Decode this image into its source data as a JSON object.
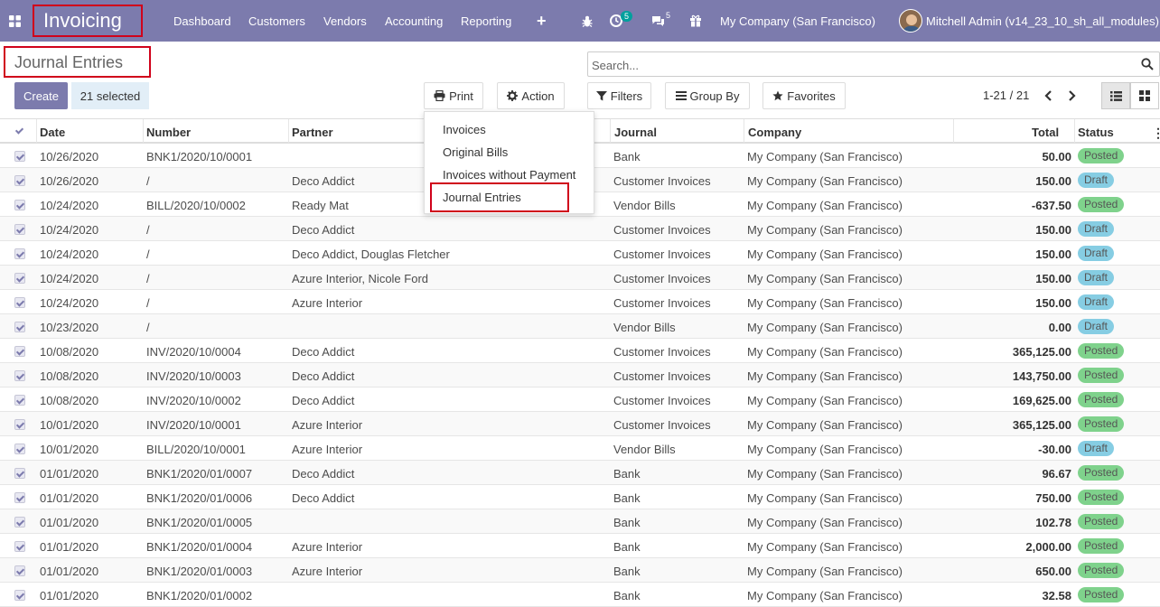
{
  "navbar": {
    "app_title": "Invoicing",
    "menus": [
      "Dashboard",
      "Customers",
      "Vendors",
      "Accounting",
      "Reporting"
    ],
    "activity_count": "5",
    "messages_count": "5",
    "company": "My Company (San Francisco)",
    "user": "Mitchell Admin (v14_23_10_sh_all_modules)"
  },
  "control_panel": {
    "title": "Journal Entries",
    "search_placeholder": "Search...",
    "create_label": "Create",
    "selected_label": "21 selected",
    "print_label": "Print",
    "action_label": "Action",
    "filters_label": "Filters",
    "groupby_label": "Group By",
    "favorites_label": "Favorites",
    "pager": "1-21 / 21"
  },
  "print_menu": {
    "items": [
      "Invoices",
      "Original Bills",
      "Invoices without Payment",
      "Journal Entries"
    ]
  },
  "table": {
    "headers": {
      "date": "Date",
      "number": "Number",
      "partner": "Partner",
      "journal": "Journal",
      "company": "Company",
      "total": "Total",
      "status": "Status"
    },
    "rows": [
      {
        "date": "10/26/2020",
        "number": "BNK1/2020/10/0001",
        "partner": "",
        "journal": "Bank",
        "company": "My Company (San Francisco)",
        "total": "50.00",
        "status": "Posted"
      },
      {
        "date": "10/26/2020",
        "number": "/",
        "partner": "Deco Addict",
        "journal": "Customer Invoices",
        "company": "My Company (San Francisco)",
        "total": "150.00",
        "status": "Draft"
      },
      {
        "date": "10/24/2020",
        "number": "BILL/2020/10/0002",
        "partner": "Ready Mat",
        "journal": "Vendor Bills",
        "company": "My Company (San Francisco)",
        "total": "-637.50",
        "status": "Posted"
      },
      {
        "date": "10/24/2020",
        "number": "/",
        "partner": "Deco Addict",
        "journal": "Customer Invoices",
        "company": "My Company (San Francisco)",
        "total": "150.00",
        "status": "Draft"
      },
      {
        "date": "10/24/2020",
        "number": "/",
        "partner": "Deco Addict, Douglas Fletcher",
        "journal": "Customer Invoices",
        "company": "My Company (San Francisco)",
        "total": "150.00",
        "status": "Draft"
      },
      {
        "date": "10/24/2020",
        "number": "/",
        "partner": "Azure Interior, Nicole Ford",
        "journal": "Customer Invoices",
        "company": "My Company (San Francisco)",
        "total": "150.00",
        "status": "Draft"
      },
      {
        "date": "10/24/2020",
        "number": "/",
        "partner": "Azure Interior",
        "journal": "Customer Invoices",
        "company": "My Company (San Francisco)",
        "total": "150.00",
        "status": "Draft"
      },
      {
        "date": "10/23/2020",
        "number": "/",
        "partner": "",
        "journal": "Vendor Bills",
        "company": "My Company (San Francisco)",
        "total": "0.00",
        "status": "Draft"
      },
      {
        "date": "10/08/2020",
        "number": "INV/2020/10/0004",
        "partner": "Deco Addict",
        "journal": "Customer Invoices",
        "company": "My Company (San Francisco)",
        "total": "365,125.00",
        "status": "Posted"
      },
      {
        "date": "10/08/2020",
        "number": "INV/2020/10/0003",
        "partner": "Deco Addict",
        "journal": "Customer Invoices",
        "company": "My Company (San Francisco)",
        "total": "143,750.00",
        "status": "Posted"
      },
      {
        "date": "10/08/2020",
        "number": "INV/2020/10/0002",
        "partner": "Deco Addict",
        "journal": "Customer Invoices",
        "company": "My Company (San Francisco)",
        "total": "169,625.00",
        "status": "Posted"
      },
      {
        "date": "10/01/2020",
        "number": "INV/2020/10/0001",
        "partner": "Azure Interior",
        "journal": "Customer Invoices",
        "company": "My Company (San Francisco)",
        "total": "365,125.00",
        "status": "Posted"
      },
      {
        "date": "10/01/2020",
        "number": "BILL/2020/10/0001",
        "partner": "Azure Interior",
        "journal": "Vendor Bills",
        "company": "My Company (San Francisco)",
        "total": "-30.00",
        "status": "Draft"
      },
      {
        "date": "01/01/2020",
        "number": "BNK1/2020/01/0007",
        "partner": "Deco Addict",
        "journal": "Bank",
        "company": "My Company (San Francisco)",
        "total": "96.67",
        "status": "Posted"
      },
      {
        "date": "01/01/2020",
        "number": "BNK1/2020/01/0006",
        "partner": "Deco Addict",
        "journal": "Bank",
        "company": "My Company (San Francisco)",
        "total": "750.00",
        "status": "Posted"
      },
      {
        "date": "01/01/2020",
        "number": "BNK1/2020/01/0005",
        "partner": "",
        "journal": "Bank",
        "company": "My Company (San Francisco)",
        "total": "102.78",
        "status": "Posted"
      },
      {
        "date": "01/01/2020",
        "number": "BNK1/2020/01/0004",
        "partner": "Azure Interior",
        "journal": "Bank",
        "company": "My Company (San Francisco)",
        "total": "2,000.00",
        "status": "Posted"
      },
      {
        "date": "01/01/2020",
        "number": "BNK1/2020/01/0003",
        "partner": "Azure Interior",
        "journal": "Bank",
        "company": "My Company (San Francisco)",
        "total": "650.00",
        "status": "Posted"
      },
      {
        "date": "01/01/2020",
        "number": "BNK1/2020/01/0002",
        "partner": "",
        "journal": "Bank",
        "company": "My Company (San Francisco)",
        "total": "32.58",
        "status": "Posted"
      }
    ]
  },
  "colors": {
    "brand": "#7c7bad",
    "posted_badge": "#7fd28c",
    "draft_badge": "#86cde3",
    "highlight": "#d0021b"
  }
}
